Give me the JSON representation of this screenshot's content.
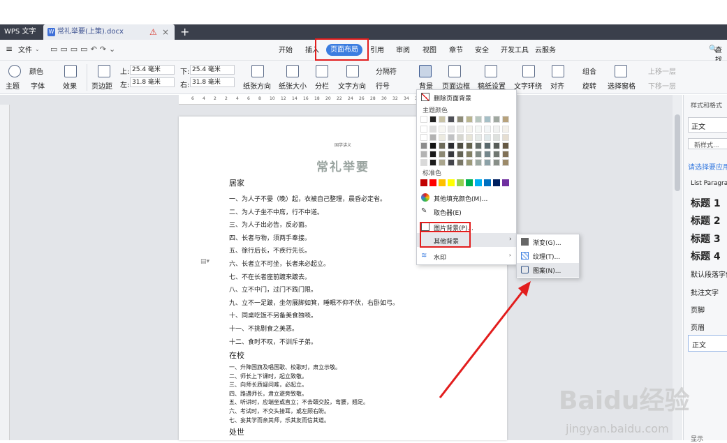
{
  "tabs": {
    "app": "WPS 文字",
    "doc": "常礼举要(上策).docx",
    "add": "+"
  },
  "menu": {
    "file": "文件",
    "items": [
      "开始",
      "插入",
      "页面布局",
      "引用",
      "审阅",
      "视图",
      "章节",
      "安全",
      "开发工具",
      "云服务"
    ],
    "active": "页面布局",
    "search": "查找"
  },
  "ribbon": {
    "theme": "主题",
    "color": "颜色",
    "font": "字体",
    "effect": "效果",
    "margin": "页边距",
    "top_label": "上:",
    "top_value": "25.4 毫米",
    "bottom_label": "下:",
    "bottom_value": "25.4 毫米",
    "left_label": "左:",
    "left_value": "31.8 毫米",
    "right_label": "右:",
    "right_value": "31.8 毫米",
    "orientation": "纸张方向",
    "size": "纸张大小",
    "columns": "分栏",
    "text_dir": "文字方向",
    "separator": "分隔符",
    "line_no": "行号",
    "background": "背景",
    "page_border": "页面边框",
    "grid_paper": "稿纸设置",
    "wrap": "文字环绕",
    "align": "对齐",
    "group": "组合",
    "rotate": "旋转",
    "select_pane": "选择窗格",
    "bring_up": "上移一层",
    "send_down": "下移一层"
  },
  "ruler": [
    "6",
    "4",
    "2",
    "2",
    "4",
    "6",
    "8",
    "10",
    "12",
    "14",
    "16",
    "18",
    "20",
    "22",
    "24",
    "26",
    "28",
    "30",
    "32",
    "34",
    "36",
    "38"
  ],
  "document": {
    "header": "国学讲义",
    "title": "常礼举要",
    "sec1": "居家",
    "lines1": [
      "一、为人子不晏（晚）起，衣被自己整理，晨昏必定省。",
      "二、为人子坐不中席，行不中道。",
      "三、为人子出必告，反必面。",
      "四、长者与物，须两手奉接。",
      "五、徐行后长，不疾行先长。",
      "六、长者立不可坐，长者来必起立。",
      "七、不在长者座前踱来踱去。",
      "八、立不中门，过门不践门限。",
      "九、立不一足跛，坐勿展脚如箕，睡眠不仰不伏，右卧如弓。",
      "十、同桌吃饭不另备美食独啖。",
      "十一、不挑剔食之美恶。",
      "十二、食时不叹，不训斥子弟。"
    ],
    "sec2": "在校",
    "lines2": [
      "一、升降国旗及唱国歌、校歌时，肃立示敬。",
      "二、师长上下课时，起立致敬。",
      "三、向师长质疑问难，必起立。",
      "四、路遇师长，肃立避旁致敬。",
      "五、听讲时，应端坐或直立；不去頤交股，弯腰，翘足。",
      "六、考试时，不交头接耳，或左顾右盼。",
      "七、妄其学而亲其师，乐其友而信其道。"
    ],
    "sec3": "处世"
  },
  "dropdown": {
    "remove": "删除页面背景",
    "theme_colors": "主题颜色",
    "standard": "标准色",
    "more_fill": "其他填充颜色(M)...",
    "picker": "取色器(E)",
    "picture": "图片背景(P)...",
    "other": "其他背景",
    "watermark": "水印"
  },
  "submenu": {
    "gradient": "渐变(G)...",
    "texture": "纹理(T)...",
    "pattern": "图案(N)..."
  },
  "side": {
    "title": "样式和格式",
    "current": "正文",
    "new": "新样式...",
    "apply": "请选择要应用",
    "list": [
      "List Paragraph",
      "标题 1",
      "标题 2",
      "标题 3",
      "标题 4",
      "默认段落字体",
      "批注文字",
      "页脚",
      "页眉",
      "正文"
    ],
    "show": "显示"
  },
  "watermark": {
    "brand": "Baidu经验",
    "url": "jingyan.baidu.com"
  },
  "colors": {
    "accent": "#3b7de0",
    "highlight": "#e21d1d"
  }
}
